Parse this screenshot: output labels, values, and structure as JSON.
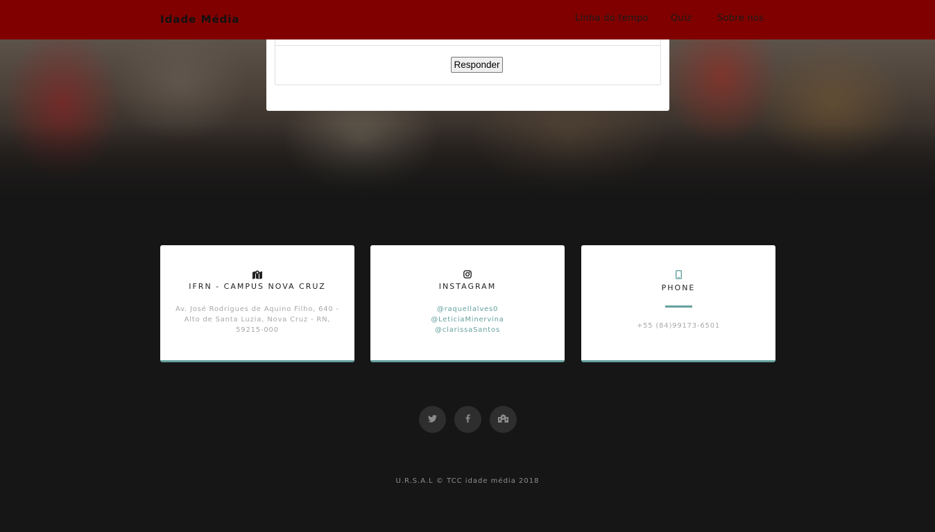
{
  "navbar": {
    "brand": "Idade Média",
    "links": [
      "Linha do tempo",
      "Quiz",
      "Sobre nos"
    ],
    "bg_color": "#800000"
  },
  "quiz": {
    "submit_label": "Responder"
  },
  "contact": [
    {
      "icon": "map-icon",
      "title": "IFRN - Campus Nova Cruz",
      "lines": [
        "Av. José Rodrigues de Aquino Filho, 640 -",
        "Alto de Santa Luzia, Nova Cruz - RN,",
        "59215-000"
      ]
    },
    {
      "icon": "instagram-icon",
      "title": "Instagram",
      "lines": [
        "@raquellalves0",
        "@LeticiaMinervina",
        "@clarissaSantos"
      ]
    },
    {
      "icon": "mobile-icon",
      "title": "Phone",
      "lines": [
        "+55 (84)99173-6501"
      ]
    }
  ],
  "social": [
    "twitter-icon",
    "facebook-icon",
    "school-icon"
  ],
  "footer": {
    "text": "U.R.S.A.L © TCC idade média 2018"
  },
  "colors": {
    "accent": "#64a19d",
    "page_bg": "#161616"
  }
}
